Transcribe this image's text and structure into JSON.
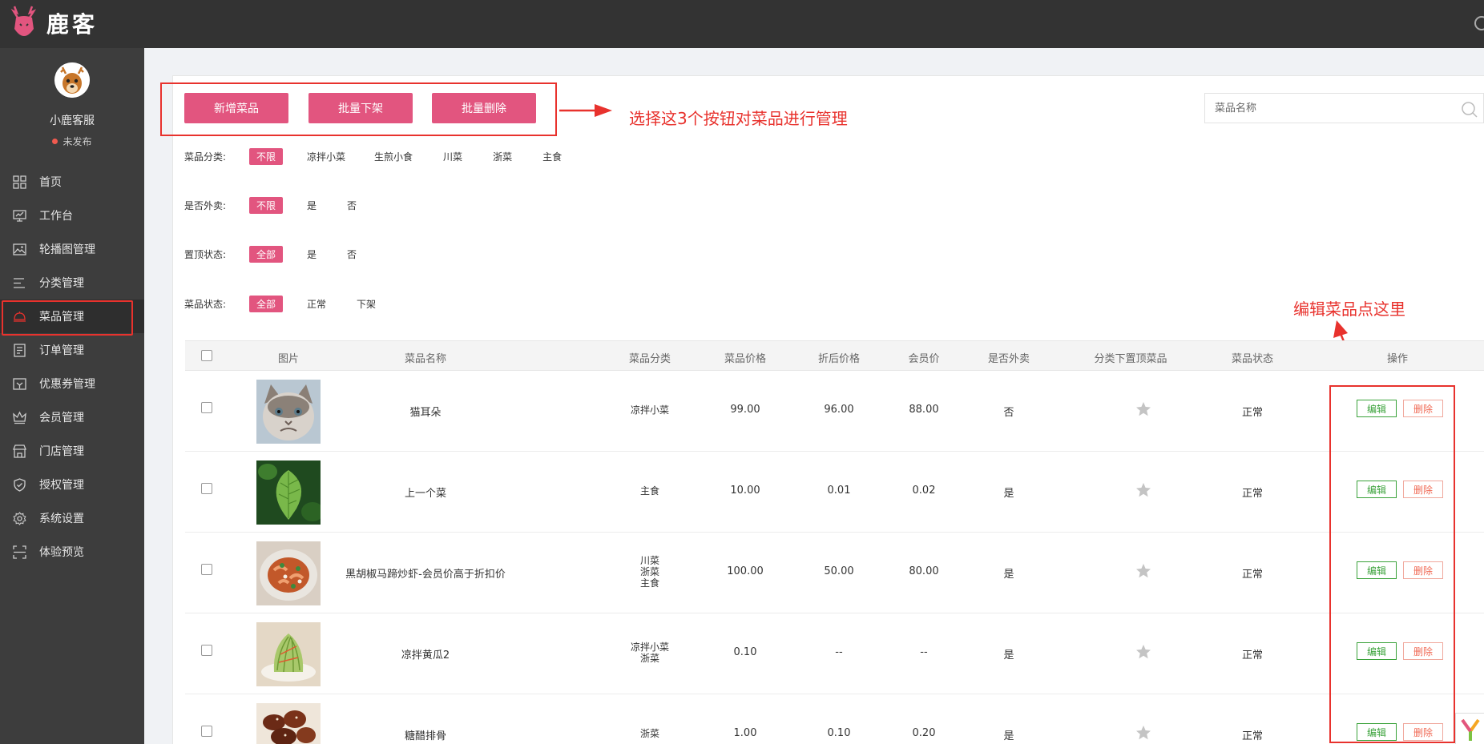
{
  "brand": {
    "name": "鹿客"
  },
  "user": {
    "name": "小鹿客服",
    "status": "未发布"
  },
  "menu": [
    {
      "label": "首页",
      "icon": "grid-icon"
    },
    {
      "label": "工作台",
      "icon": "monitor-icon"
    },
    {
      "label": "轮播图管理",
      "icon": "image-icon"
    },
    {
      "label": "分类管理",
      "icon": "list-icon"
    },
    {
      "label": "菜品管理",
      "icon": "cloche-icon",
      "active": true
    },
    {
      "label": "订单管理",
      "icon": "document-icon"
    },
    {
      "label": "优惠券管理",
      "icon": "coupon-icon"
    },
    {
      "label": "会员管理",
      "icon": "crown-icon"
    },
    {
      "label": "门店管理",
      "icon": "store-icon"
    },
    {
      "label": "授权管理",
      "icon": "shield-icon"
    },
    {
      "label": "系统设置",
      "icon": "gear-icon"
    },
    {
      "label": "体验预览",
      "icon": "scan-icon"
    }
  ],
  "toolbar": {
    "add_label": "新增菜品",
    "offshelf_label": "批量下架",
    "delete_label": "批量删除"
  },
  "annotations": {
    "buttons_note": "选择这3个按钮对菜品进行管理",
    "edit_note": "编辑菜品点这里"
  },
  "search": {
    "placeholder": "菜品名称"
  },
  "filters": [
    {
      "label": "菜品分类:",
      "options": [
        "不限",
        "凉拌小菜",
        "生煎小食",
        "川菜",
        "浙菜",
        "主食"
      ]
    },
    {
      "label": "是否外卖:",
      "options": [
        "不限",
        "是",
        "否"
      ]
    },
    {
      "label": "置顶状态:",
      "options": [
        "全部",
        "是",
        "否"
      ]
    },
    {
      "label": "菜品状态:",
      "options": [
        "全部",
        "正常",
        "下架"
      ]
    }
  ],
  "table": {
    "headers": {
      "image": "图片",
      "name": "菜品名称",
      "category": "菜品分类",
      "price": "菜品价格",
      "discount": "折后价格",
      "member": "会员价",
      "takeout": "是否外卖",
      "pinned": "分类下置顶菜品",
      "status": "菜品状态",
      "ops": "操作"
    },
    "edit_label": "编辑",
    "delete_label": "删除",
    "rows": [
      {
        "name": "猫耳朵",
        "category": [
          "凉拌小菜"
        ],
        "price": "99.00",
        "discount": "96.00",
        "member": "88.00",
        "takeout": "否",
        "status": "正常"
      },
      {
        "name": "上一个菜",
        "category": [
          "主食"
        ],
        "price": "10.00",
        "discount": "0.01",
        "member": "0.02",
        "takeout": "是",
        "status": "正常"
      },
      {
        "name": "黑胡椒马蹄炒虾-会员价高于折扣价",
        "category": [
          "川菜",
          "浙菜",
          "主食"
        ],
        "price": "100.00",
        "discount": "50.00",
        "member": "80.00",
        "takeout": "是",
        "status": "正常"
      },
      {
        "name": "凉拌黄瓜2",
        "category": [
          "凉拌小菜",
          "浙菜"
        ],
        "price": "0.10",
        "discount": "--",
        "member": "--",
        "takeout": "是",
        "status": "正常"
      },
      {
        "name": "糖醋排骨",
        "category": [
          "浙菜"
        ],
        "price": "1.00",
        "discount": "0.10",
        "member": "0.20",
        "takeout": "是",
        "status": "正常"
      }
    ]
  },
  "colors": {
    "accent": "#e2557f",
    "annotation": "#e8322d",
    "sidebar": "#3d3d3d",
    "topbar": "#333333"
  }
}
